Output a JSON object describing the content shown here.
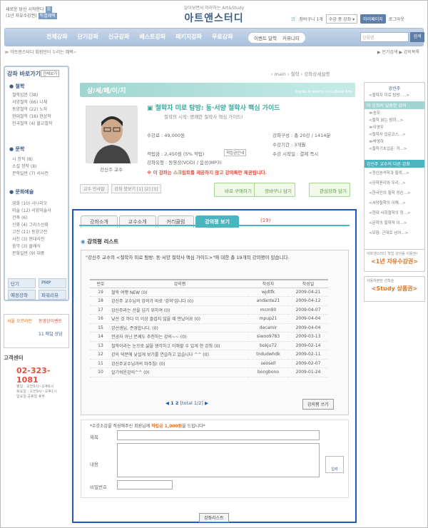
{
  "header": {
    "logo_line1": "새로운 당신 시작한다",
    "logo_badge1": "회",
    "logo_line2": "1년 자유수강권",
    "logo_badge2": "특별혜택",
    "brand_sub": "살아보면서 마라하는 Art&Study",
    "brand_title": "아트앤스터디",
    "cart": "장바구니 1개",
    "select": "수강 중 강좌",
    "mypage": "마이페이지",
    "logout": "로그아웃"
  },
  "nav": {
    "items": [
      "전체강좌",
      "단기강좌",
      "신규강좌",
      "베스트강좌",
      "패키지강좌",
      "무료강좌"
    ],
    "event": "이벤트 달력",
    "community": "커뮤니티",
    "search_placeholder": "강좌명",
    "search_btn": "검색"
  },
  "subbar": {
    "left": "≫ 아트앤스터디 회원만이 누리는 혜택~",
    "right": "▶ 인기검색 ▶ 강의목록"
  },
  "left": {
    "title": "강좌 바로가기",
    "title_btn": "전체보기",
    "cat1": "철학",
    "cat1_items": [
      "철학입문 (38)",
      "서양철학 (66) 니체",
      "동양철학 (22) 노자",
      "현대철학 (18) 현상학",
      "한국철학 (4) 불교철학"
    ],
    "cat2": "문학",
    "cat2_items": [
      "시 창작 (8)",
      "소설 창작 (8)",
      "문학일반 (7) 서사전"
    ],
    "cat3": "문화예술",
    "cat3_items": [
      "영화 (10) 시나리오",
      "미술 (12) 서양미술사",
      "건축 (6)",
      "신화 (4) 그리스신화",
      "고전 (11) 동양고전",
      "사진 (3) 현대사진",
      "음악 (3) 클래식",
      "문화일반 (9) 대중"
    ],
    "btns": [
      "단기",
      "PMP",
      "예정강좌",
      "파워리뷰"
    ],
    "promo1": "서울 오프라인",
    "promo2": "동영상이벤트",
    "promo3": "11 매일 상담",
    "cs_title": "고객센터",
    "cs_tel": "02-323-1081",
    "cs_txt": [
      "평일 : 오전9시~오후6시",
      "토요일 : 오전9시~오후1시",
      "일요일·공휴일 휴무"
    ]
  },
  "main": {
    "crumb": "› main › 철학 › 강좌상세설명",
    "section": "상/세/페/이/지",
    "section_en": "Digital Academy of Cultural Arts",
    "prof": "강신주 교수",
    "course_title": "철학자 미로 탐방: 동·서양 철학사 핵심 가이드",
    "course_sub": "철학의 시작: 명쾌한 철학사 핵심 가이드!",
    "price": "수강료 : 49,000원",
    "points": "적립금 : 2,450원 (5% 적립)",
    "points_btn": "적립금안내",
    "type": "강좌유형 : 동영상(VOD) / 음성(MP3)",
    "count": "강좌구성 : 총 20강 / 1414분",
    "period": "수강기간 : 3개월",
    "start": "수강 시작일 : 결제 즉시",
    "notice": "※ 이 강좌는 스크립트를 제공하지 않고 강의록만 제공됩니다.",
    "sm": [
      "교수 인사말",
      "강좌 맛보기 [1] [2] [3]"
    ],
    "btn1": "바로 구매하기",
    "btn2": "장바구니 담기",
    "btn3": "관심강좌 담기"
  },
  "panel": {
    "tabs": [
      "강좌소개",
      "교수소개",
      "커리큘럼",
      "강의평 보기"
    ],
    "tab_count": "(19)",
    "review_title": "강의평 리스트",
    "box_head": "\"강신주 교수의 <철학자 미로 탐방: 동·서양 철학사 핵심 가이드>\"에 대한 총 19개의 강의평이 있습니다.",
    "cols": [
      "번호",
      "강의평",
      "작성자",
      "작성일"
    ],
    "rows": [
      [
        "19",
        "철학 여행 NEW (0)",
        "wjdtfk",
        "2009-04-21"
      ],
      [
        "18",
        "강신주 교수님의 강의가 바로 '강의'입니다 (0)",
        "andante21",
        "2009-04-12"
      ],
      [
        "17",
        "강신주라는 산을 넘기 위하여 (0)",
        "mcm90",
        "2009-04-07"
      ],
      [
        "16",
        "낯선 것 하다 더 이상 즐겁지 않을 때 만났어요 (0)",
        "mpup21",
        "2009-04-04"
      ],
      [
        "15",
        "강선생님, 존경합니다. (0)",
        "decamir",
        "2009-04-04"
      ],
      [
        "14",
        "전공자 아닌 분께도 추천하는 강의~~ (0)",
        "siwoo9783",
        "2009-03-13"
      ],
      [
        "13",
        "철학이라는 눈으로 삶을 생각하고 이해할 수 있게 한 강좌 (0)",
        "bokju72",
        "2009-02-14"
      ],
      [
        "12",
        "강의 덕분에 낯설게 보기를 연습하고 있습니다 ^^ (0)",
        "tndudwhdk",
        "2009-02-11"
      ],
      [
        "11",
        "강신주교수님과의 마주침! (0)",
        "seosell",
        "2009-02-07"
      ],
      [
        "10",
        "알기쉬운강의^^ (0)",
        "bongbono",
        "2009-01-24"
      ]
    ],
    "pager_pages": "1 2",
    "pager_total": "[total 1/2]",
    "write_btn": "강의평 쓰기",
    "form_head_a": "*수강소감을 작성해주신 회원님께 ",
    "form_head_b": "적립금 1,000원",
    "form_head_c": "을 드립니다*",
    "f_title": "제목",
    "f_body": "내용",
    "f_pw": "비밀번호",
    "submit": "입력",
    "list_btn": "강좌리스트"
  },
  "right": {
    "hd1": "강신주",
    "items1": [
      "<철학자 미로 탐방: ...>"
    ],
    "hd2": "이 강좌의 달콤한 강의",
    "items2": [
      "≫송모",
      "<철학 읽는 밤하...>",
      "≫이영우",
      "<철학사 입문코스...>",
      "≫박영하",
      "<철학기초입문: 카...>"
    ],
    "hd3": "강신주 교수의 다른 강좌",
    "items3": [
      "<정신분석학과 들뢰...>",
      "<공학윤리와 우리...>",
      "<한국인의 철학 정신...>",
      "<서양철학의 이해...>",
      "<현대 사회철학의 정...>",
      "<문학의 철학적 이...>",
      "<모함: 근대로 넘어...>"
    ],
    "ad1_s": "아트앤스터디 학업 강의를 이용권!",
    "ad1_b": "<1년 자유수강권>",
    "ad2_s": "사용자분만 선착순",
    "ad2_b": "<Study 상품권>"
  }
}
